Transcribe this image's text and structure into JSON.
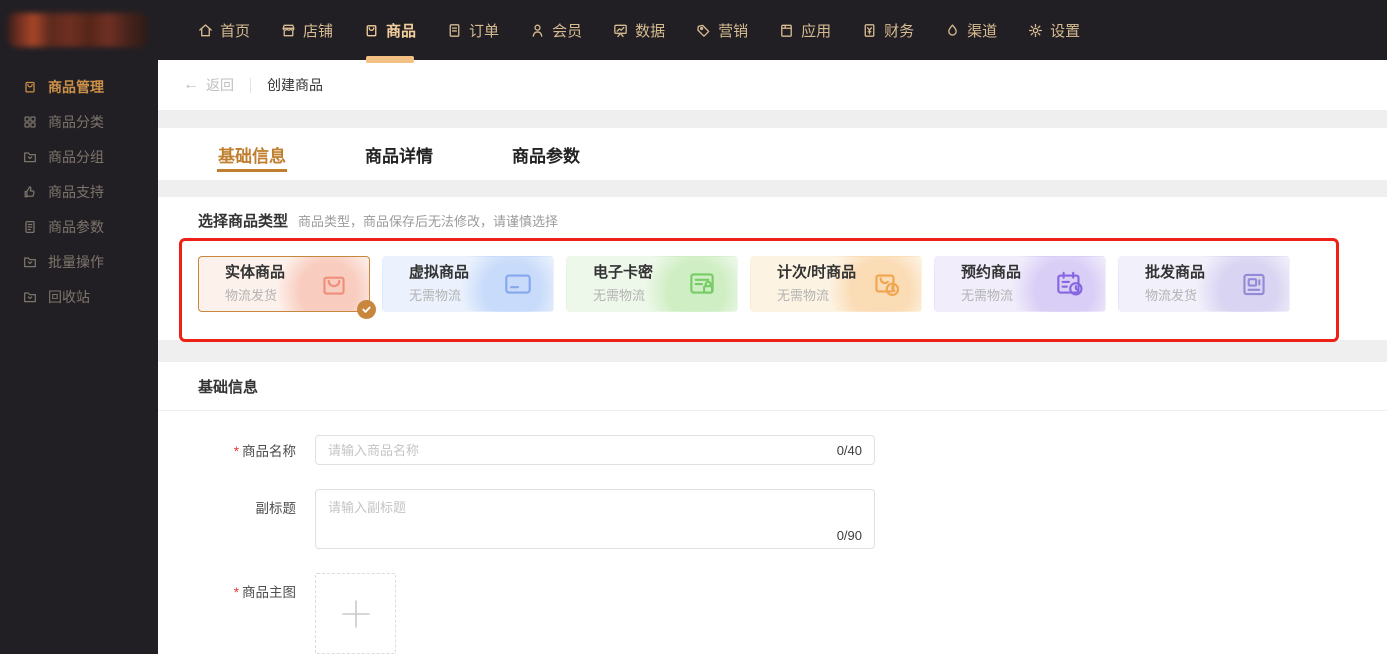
{
  "topnav": {
    "items": [
      {
        "label": "首页",
        "icon": "home-icon",
        "active": false
      },
      {
        "label": "店铺",
        "icon": "shop-icon",
        "active": false
      },
      {
        "label": "商品",
        "icon": "goods-icon",
        "active": true
      },
      {
        "label": "订单",
        "icon": "order-icon",
        "active": false
      },
      {
        "label": "会员",
        "icon": "member-icon",
        "active": false
      },
      {
        "label": "数据",
        "icon": "data-icon",
        "active": false
      },
      {
        "label": "营销",
        "icon": "marketing-icon",
        "active": false
      },
      {
        "label": "应用",
        "icon": "apps-icon",
        "active": false
      },
      {
        "label": "财务",
        "icon": "finance-icon",
        "active": false
      },
      {
        "label": "渠道",
        "icon": "channel-icon",
        "active": false
      },
      {
        "label": "设置",
        "icon": "settings-icon",
        "active": false
      }
    ]
  },
  "sidebar": {
    "items": [
      {
        "label": "商品管理",
        "icon": "goods-icon",
        "active": true
      },
      {
        "label": "商品分类",
        "icon": "grid-icon",
        "active": false
      },
      {
        "label": "商品分组",
        "icon": "folder-icon",
        "active": false
      },
      {
        "label": "商品支持",
        "icon": "like-icon",
        "active": false
      },
      {
        "label": "商品参数",
        "icon": "doc-icon",
        "active": false
      },
      {
        "label": "批量操作",
        "icon": "folder-icon",
        "active": false
      },
      {
        "label": "回收站",
        "icon": "folder-icon",
        "active": false
      }
    ]
  },
  "breadcrumb": {
    "back_label": "返回",
    "back_arrow": "←",
    "title": "创建商品"
  },
  "tabs": [
    {
      "label": "基础信息",
      "active": true
    },
    {
      "label": "商品详情",
      "active": false
    },
    {
      "label": "商品参数",
      "active": false
    }
  ],
  "type_section": {
    "title": "选择商品类型",
    "note": "商品类型，商品保存后无法修改，请谨慎选择",
    "cards": [
      {
        "title": "实体商品",
        "subtitle": "物流发货",
        "icon": "bag-icon",
        "selected": true,
        "icon_color": "#ef8f7a",
        "bg": "#fdf1ec",
        "blob": "rgba(243,150,125,0.40)",
        "border": "#c9863d"
      },
      {
        "title": "虚拟商品",
        "subtitle": "无需物流",
        "icon": "virtual-card-icon",
        "selected": false,
        "icon_color": "#84a8ef",
        "bg": "#ebf2fd",
        "blob": "rgba(150,185,245,0.40)",
        "border": "transparent"
      },
      {
        "title": "电子卡密",
        "subtitle": "无需物流",
        "icon": "card-lock-icon",
        "selected": false,
        "icon_color": "#76cc65",
        "bg": "#eef8ea",
        "blob": "rgba(150,220,125,0.35)",
        "border": "transparent"
      },
      {
        "title": "计次/时商品",
        "subtitle": "无需物流",
        "icon": "bag-clock-icon",
        "selected": false,
        "icon_color": "#f0a54f",
        "bg": "#fdf3e3",
        "blob": "rgba(246,180,105,0.38)",
        "border": "transparent"
      },
      {
        "title": "预约商品",
        "subtitle": "无需物流",
        "icon": "calendar-clock-icon",
        "selected": false,
        "icon_color": "#8766e2",
        "bg": "#f1edfb",
        "blob": "rgba(165,140,235,0.32)",
        "border": "transparent"
      },
      {
        "title": "批发商品",
        "subtitle": "物流发货",
        "icon": "clipboard-icon",
        "selected": false,
        "icon_color": "#938ad7",
        "bg": "#f2f0fb",
        "blob": "rgba(170,162,225,0.35)",
        "border": "transparent"
      }
    ]
  },
  "basic_section": {
    "title": "基础信息",
    "required_mark": "*",
    "fields": [
      {
        "label": "商品名称",
        "placeholder": "请输入商品名称",
        "counter": "0/40"
      },
      {
        "label": "副标题",
        "placeholder": "请输入副标题",
        "counter": "0/90"
      },
      {
        "label": "商品主图"
      }
    ]
  },
  "colors": {
    "topbar_bg": "#211f24",
    "nav_text": "#d6bb91",
    "nav_active": "#f2cf9c",
    "nav_underline": "#f2c083",
    "sidebar_active": "#cd9049",
    "tab_active": "#bf7f2f",
    "annotation_red": "#ee2116",
    "check_badge": "#c9863d"
  }
}
